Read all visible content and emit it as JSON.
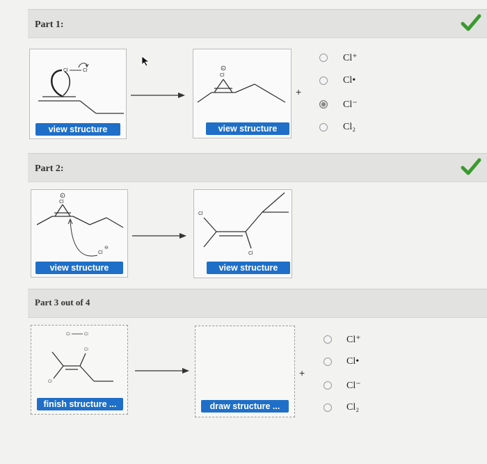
{
  "parts": [
    {
      "title": "Part 1:",
      "status": "correct",
      "buttons": [
        "view structure",
        "view structure"
      ],
      "plus": "+",
      "options": [
        {
          "label": "Cl⁺",
          "selected": false
        },
        {
          "label": "Cl•",
          "selected": false
        },
        {
          "label": "Cl⁻",
          "selected": true
        },
        {
          "label": "Cl₂",
          "selected": false
        }
      ]
    },
    {
      "title": "Part 2:",
      "status": "correct",
      "buttons": [
        "view structure",
        "view structure"
      ]
    },
    {
      "title": "Part 3 out of 4",
      "buttons": [
        "finish structure ...",
        "draw structure ..."
      ],
      "plus": "+",
      "options": [
        {
          "label": "Cl⁺",
          "selected": false
        },
        {
          "label": "Cl•",
          "selected": false
        },
        {
          "label": "Cl⁻",
          "selected": false
        },
        {
          "label": "Cl₂",
          "selected": false
        }
      ]
    }
  ],
  "atoms": {
    "cl": "Cl",
    "minus": "⊖"
  },
  "colors": {
    "button": "#1f6fc8",
    "check": "#3a9a2e",
    "header": "#e2e2e0"
  }
}
